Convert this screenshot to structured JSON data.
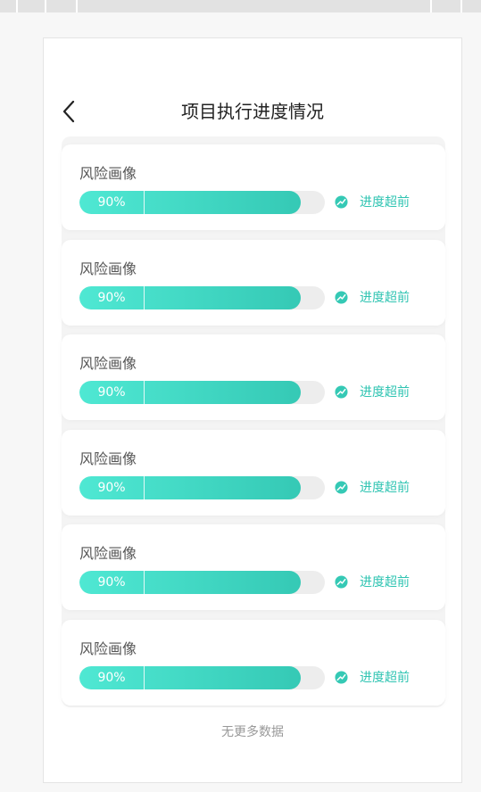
{
  "page_title": "项目执行进度情况",
  "footer_text": "无更多数据",
  "colors": {
    "accent": "#35c9b5",
    "accent_light": "#4fe8d3",
    "status_text": "#2fc4b2"
  },
  "icons": {
    "back": "chevron-left-icon",
    "trend": "trend-up-icon"
  },
  "items": [
    {
      "title": "风险画像",
      "progress": 90,
      "progress_label": "90%",
      "status": "进度超前"
    },
    {
      "title": "风险画像",
      "progress": 90,
      "progress_label": "90%",
      "status": "进度超前"
    },
    {
      "title": "风险画像",
      "progress": 90,
      "progress_label": "90%",
      "status": "进度超前"
    },
    {
      "title": "风险画像",
      "progress": 90,
      "progress_label": "90%",
      "status": "进度超前"
    },
    {
      "title": "风险画像",
      "progress": 90,
      "progress_label": "90%",
      "status": "进度超前"
    },
    {
      "title": "风险画像",
      "progress": 90,
      "progress_label": "90%",
      "status": "进度超前"
    }
  ]
}
